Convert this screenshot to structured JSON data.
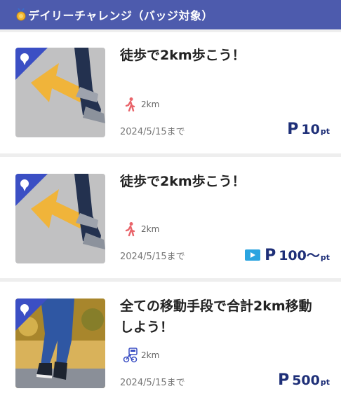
{
  "header": {
    "title": "デイリーチャレンジ（バッジ対象）",
    "icon": "medal-icon"
  },
  "challenges": [
    {
      "title": "徒歩で2km歩こう！",
      "metric_icon": "walk-icon",
      "metric": "2km",
      "deadline": "2024/5/15まで",
      "points": "10",
      "unit": "pt",
      "video": false
    },
    {
      "title": "徒歩で2km歩こう！",
      "metric_icon": "walk-icon",
      "metric": "2km",
      "deadline": "2024/5/15まで",
      "points": "100〜",
      "unit": "pt",
      "video": true
    },
    {
      "title_line1": "全ての移動手段で合計2km移動",
      "title_line2": "しよう！",
      "metric_icon": "transport-icon",
      "metric": "2km",
      "deadline": "2024/5/15まで",
      "points": "500",
      "unit": "pt",
      "video": false
    }
  ],
  "colors": {
    "header": "#4d5bad",
    "points": "#1e2f78",
    "badge": "#3b4fc4",
    "walk": "#e9646a"
  }
}
